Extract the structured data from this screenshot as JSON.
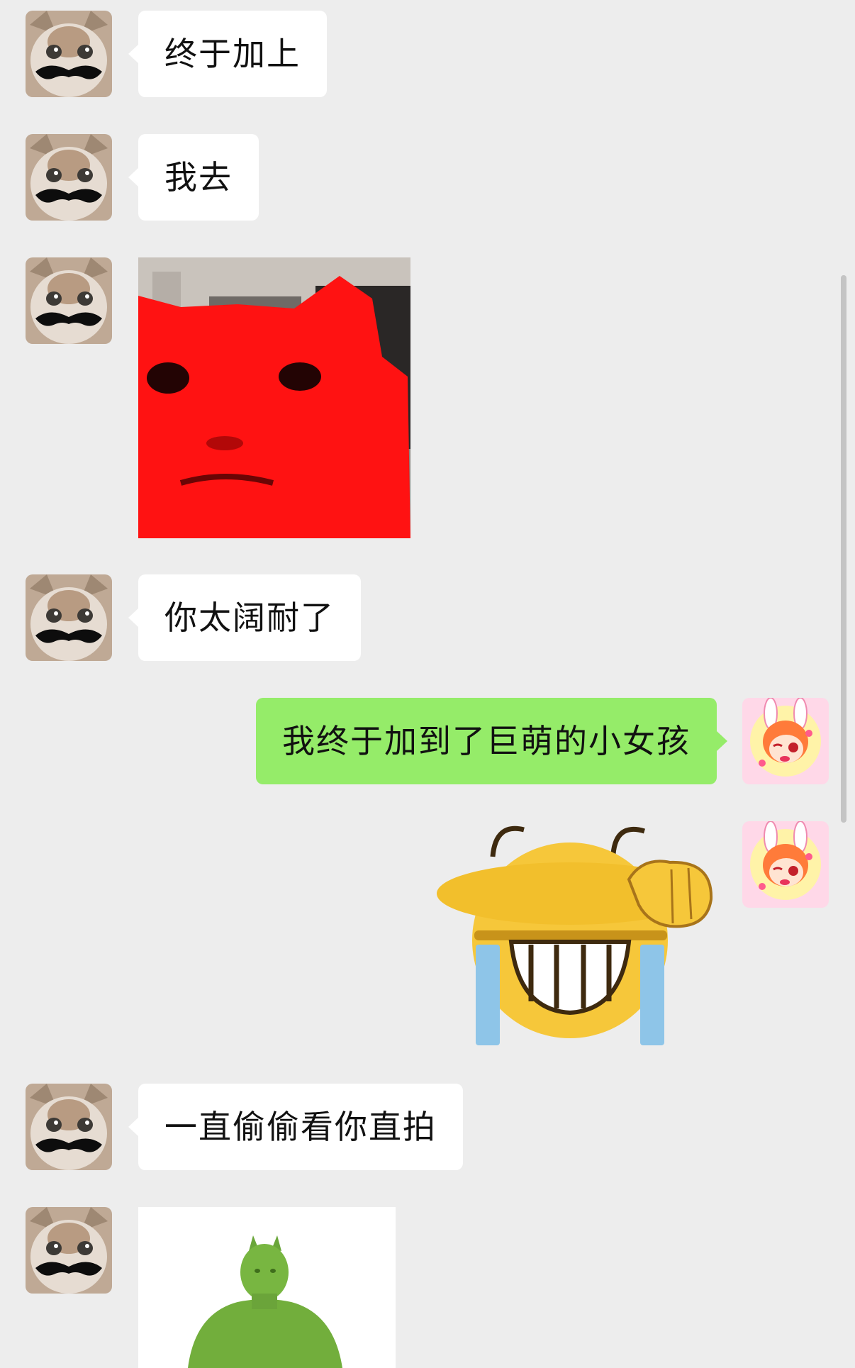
{
  "messages": [
    {
      "side": "left",
      "type": "text",
      "text": "终于加上"
    },
    {
      "side": "left",
      "type": "text",
      "text": "我去"
    },
    {
      "side": "left",
      "type": "image",
      "sticker": "red-cat-sticker"
    },
    {
      "side": "left",
      "type": "text",
      "text": "你太阔耐了"
    },
    {
      "side": "right",
      "type": "text",
      "text": "我终于加到了巨萌的小女孩"
    },
    {
      "side": "right",
      "type": "image",
      "sticker": "crying-laughing-emoji-sticker"
    },
    {
      "side": "left",
      "type": "text",
      "text": "一直偷偷看你直拍"
    },
    {
      "side": "left",
      "type": "image",
      "sticker": "green-figure-sticker"
    }
  ],
  "colors": {
    "background": "#ededed",
    "incoming_bubble": "#ffffff",
    "outgoing_bubble": "#95ec69"
  },
  "icons": {
    "left_avatar": "cat-with-mustache-avatar",
    "right_avatar": "anime-bunny-girl-avatar"
  }
}
